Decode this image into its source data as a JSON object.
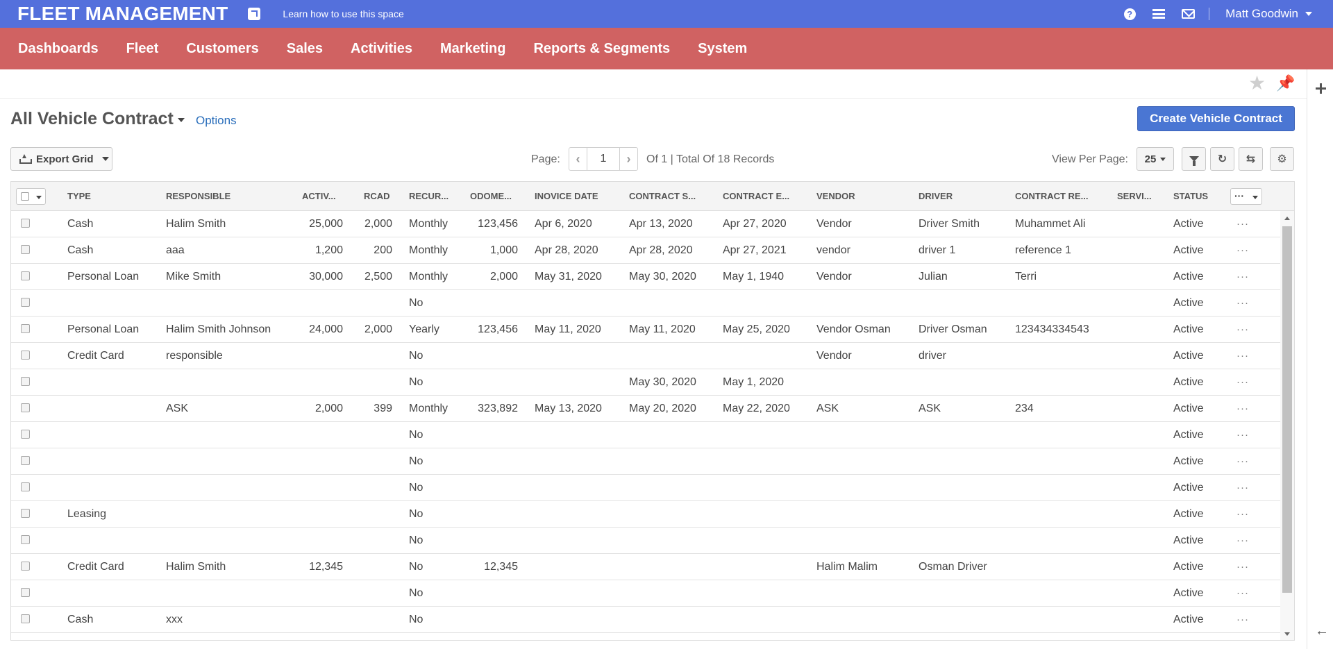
{
  "topbar": {
    "brand": "FLEET MANAGEMENT",
    "learn_link": "Learn how to use this space",
    "user_name": "Matt Goodwin",
    "icons": [
      "external-link-icon",
      "help-icon",
      "menu-icon",
      "mail-icon"
    ]
  },
  "nav": {
    "items": [
      "Dashboards",
      "Fleet",
      "Customers",
      "Sales",
      "Activities",
      "Marketing",
      "Reports & Segments",
      "System"
    ]
  },
  "page": {
    "title": "All Vehicle Contract",
    "options_label": "Options",
    "create_button": "Create Vehicle Contract"
  },
  "toolbar": {
    "export_label": "Export Grid",
    "page_label": "Page:",
    "page_value": "1",
    "page_info": "Of 1 | Total Of 18 Records",
    "view_per_page_label": "View Per Page:",
    "view_per_page_value": "25"
  },
  "grid": {
    "columns": [
      "TYPE",
      "RESPONSIBLE",
      "ACTIV...",
      "RCAD",
      "RECUR...",
      "ODOME...",
      "INOVICE DATE",
      "CONTRACT S...",
      "CONTRACT E...",
      "VENDOR",
      "DRIVER",
      "CONTRACT RE...",
      "SERVI...",
      "STATUS"
    ],
    "more_label": "···",
    "rows": [
      [
        "Cash",
        "Halim Smith",
        "25,000",
        "2,000",
        "Monthly",
        "123,456",
        "Apr 6, 2020",
        "Apr 13, 2020",
        "Apr 27, 2020",
        "Vendor",
        "Driver Smith",
        "Muhammet Ali",
        "",
        "Active"
      ],
      [
        "Cash",
        "aaa",
        "1,200",
        "200",
        "Monthly",
        "1,000",
        "Apr 28, 2020",
        "Apr 28, 2020",
        "Apr 27, 2021",
        "vendor",
        "driver 1",
        "reference 1",
        "",
        "Active"
      ],
      [
        "Personal Loan",
        "Mike Smith",
        "30,000",
        "2,500",
        "Monthly",
        "2,000",
        "May 31, 2020",
        "May 30, 2020",
        "May 1, 1940",
        "Vendor",
        "Julian",
        "Terri",
        "",
        "Active"
      ],
      [
        "",
        "",
        "",
        "",
        "No",
        "",
        "",
        "",
        "",
        "",
        "",
        "",
        "",
        "Active"
      ],
      [
        "Personal Loan",
        "Halim Smith Johnson",
        "24,000",
        "2,000",
        "Yearly",
        "123,456",
        "May 11, 2020",
        "May 11, 2020",
        "May 25, 2020",
        "Vendor Osman",
        "Driver Osman",
        "123434334543",
        "",
        "Active"
      ],
      [
        "Credit Card",
        "responsible",
        "",
        "",
        "No",
        "",
        "",
        "",
        "",
        "Vendor",
        "driver",
        "",
        "",
        "Active"
      ],
      [
        "",
        "",
        "",
        "",
        "No",
        "",
        "",
        "May 30, 2020",
        "May 1, 2020",
        "",
        "",
        "",
        "",
        "Active"
      ],
      [
        "",
        "ASK",
        "2,000",
        "399",
        "Monthly",
        "323,892",
        "May 13, 2020",
        "May 20, 2020",
        "May 22, 2020",
        "ASK",
        "ASK",
        "234",
        "",
        "Active"
      ],
      [
        "",
        "",
        "",
        "",
        "No",
        "",
        "",
        "",
        "",
        "",
        "",
        "",
        "",
        "Active"
      ],
      [
        "",
        "",
        "",
        "",
        "No",
        "",
        "",
        "",
        "",
        "",
        "",
        "",
        "",
        "Active"
      ],
      [
        "",
        "",
        "",
        "",
        "No",
        "",
        "",
        "",
        "",
        "",
        "",
        "",
        "",
        "Active"
      ],
      [
        "Leasing",
        "",
        "",
        "",
        "No",
        "",
        "",
        "",
        "",
        "",
        "",
        "",
        "",
        "Active"
      ],
      [
        "",
        "",
        "",
        "",
        "No",
        "",
        "",
        "",
        "",
        "",
        "",
        "",
        "",
        "Active"
      ],
      [
        "Credit Card",
        "Halim Smith",
        "12,345",
        "",
        "No",
        "12,345",
        "",
        "",
        "",
        "Halim Malim",
        "Osman Driver",
        "",
        "",
        "Active"
      ],
      [
        "",
        "",
        "",
        "",
        "No",
        "",
        "",
        "",
        "",
        "",
        "",
        "",
        "",
        "Active"
      ],
      [
        "Cash",
        "xxx",
        "",
        "",
        "No",
        "",
        "",
        "",
        "",
        "",
        "",
        "",
        "",
        "Active"
      ]
    ]
  }
}
